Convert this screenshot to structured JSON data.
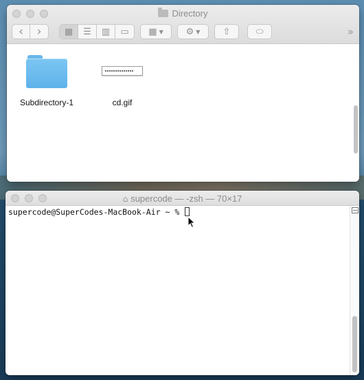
{
  "finder": {
    "title": "Directory",
    "toolbar": {
      "back": "‹",
      "forward": "›",
      "view_icon": "▦",
      "view_list": "☰",
      "view_column": "▥",
      "view_gallery": "▭",
      "group": "▦",
      "action": "⚙",
      "share": "⇧",
      "tag": "⬭",
      "more": "»"
    },
    "items": [
      {
        "label": "Subdirectory-1",
        "icon": "folder-icon"
      },
      {
        "label": "cd.gif",
        "icon": "gif-file-icon"
      }
    ]
  },
  "terminal": {
    "title": "supercode — -zsh — 70×17",
    "prompt": "supercode@SuperCodes-MacBook-Air ~ % "
  }
}
